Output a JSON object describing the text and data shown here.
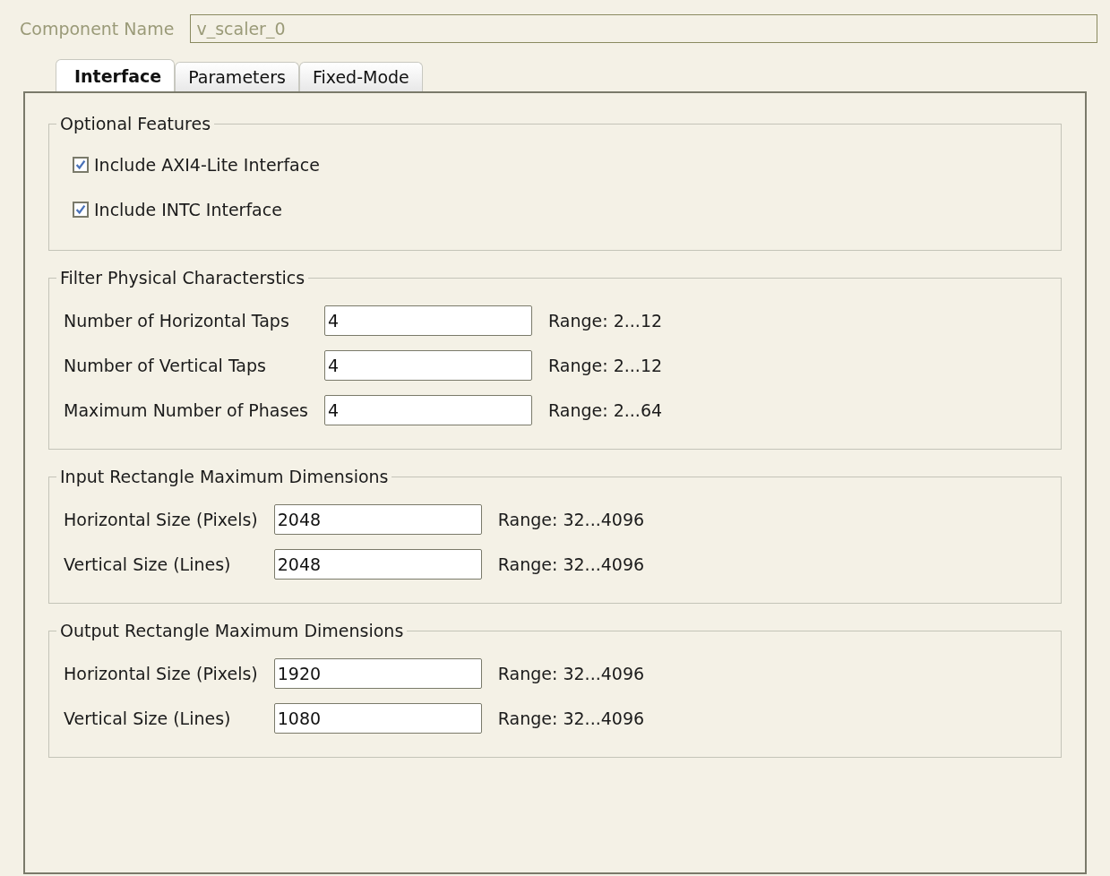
{
  "component_name": {
    "label": "Component Name",
    "value": "v_scaler_0",
    "disabled": true
  },
  "tabs": [
    {
      "label": "Interface",
      "selected": true
    },
    {
      "label": "Parameters",
      "selected": false
    },
    {
      "label": "Fixed-Mode",
      "selected": false
    }
  ],
  "groups": [
    {
      "kind": "checkboxes",
      "title": "Optional Features",
      "items": [
        {
          "label": "Include AXI4-Lite Interface",
          "checked": true
        },
        {
          "label": "Include INTC Interface",
          "checked": true
        }
      ]
    },
    {
      "kind": "fields",
      "title": "Filter Physical Characterstics",
      "items": [
        {
          "label": "Number of Horizontal Taps",
          "value": "4",
          "range": "Range: 2...12"
        },
        {
          "label": "Number of Vertical Taps",
          "value": "4",
          "range": "Range: 2...12"
        },
        {
          "label": "Maximum Number of Phases",
          "value": "4",
          "range": "Range: 2...64"
        }
      ]
    },
    {
      "kind": "fields",
      "title": "Input Rectangle Maximum Dimensions",
      "items": [
        {
          "label": "Horizontal Size (Pixels)",
          "value": "2048",
          "range": "Range: 32...4096"
        },
        {
          "label": "Vertical Size (Lines)",
          "value": "2048",
          "range": "Range: 32...4096"
        }
      ]
    },
    {
      "kind": "fields",
      "title": "Output Rectangle Maximum Dimensions",
      "items": [
        {
          "label": "Horizontal Size (Pixels)",
          "value": "1920",
          "range": "Range: 32...4096"
        },
        {
          "label": "Vertical Size (Lines)",
          "value": "1080",
          "range": "Range: 32...4096"
        }
      ]
    }
  ]
}
